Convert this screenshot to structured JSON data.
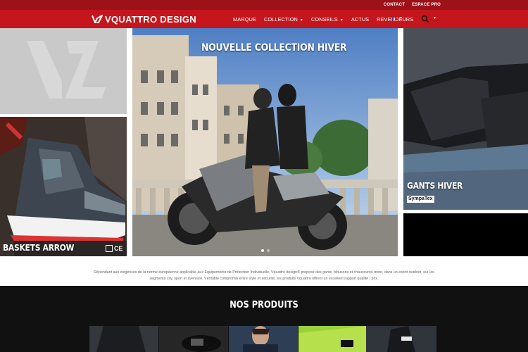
{
  "topbar": {
    "links": [
      "CONTACT",
      "ESPACE PRO"
    ],
    "icons": [
      "helmet-brand-icon",
      "document-icon",
      "vq-badge-icon"
    ]
  },
  "header": {
    "logo_text": "VQUATTRO DESIGN",
    "nav": [
      {
        "label": "MARQUE",
        "dropdown": false
      },
      {
        "label": "COLLECTION",
        "dropdown": true
      },
      {
        "label": "CONSEILS",
        "dropdown": true
      },
      {
        "label": "ACTUS",
        "dropdown": false
      },
      {
        "label": "REVENDEURS",
        "dropdown": false
      }
    ],
    "language_flag": "french-flag-icon",
    "search_icon": "search-icon"
  },
  "hero": {
    "center_caption": "NOUVELLE COLLECTION HIVER",
    "left_bottom_caption": "BASKETS ARROW",
    "right_caption": "GANTS HIVER",
    "right_brand_badge": "SympaTex",
    "certification_marks": "CE",
    "slider_dots": 2,
    "active_dot": 0
  },
  "description": "Répondant aux exigences de la norme européenne applicable aux Equipements de Protection Individuelle, Vquattro design® propose des gants, blousons et chaussures moto, dans un esprit outdoor, sur les segments city, sport et aventure. Véritable compromis entre style et sécurité, les produits Vquattro offrent un excellent rapport qualité / prix.",
  "products": {
    "title": "NOS PRODUITS"
  },
  "colors": {
    "topbar": "#9d1219",
    "navbar": "#c4161c",
    "products_bg": "#111111"
  }
}
